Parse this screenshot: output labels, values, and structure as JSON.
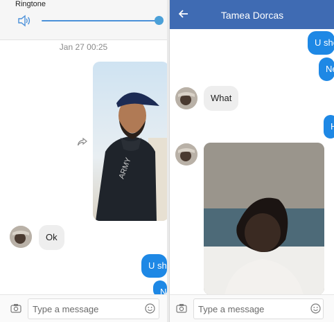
{
  "left": {
    "ringtone_label": "Ringtone",
    "volume_level": 0.95,
    "date_separator": "Jan 27 00:25",
    "messages_in": [
      {
        "text": "Ok"
      }
    ],
    "messages_out": [
      {
        "text": "U she"
      },
      {
        "text": "Ne"
      }
    ],
    "composer": {
      "placeholder": "Type a message"
    }
  },
  "right": {
    "contact_name": "Tamea Dorcas",
    "messages_out": [
      {
        "text": "U sho"
      },
      {
        "text": "Ne"
      },
      {
        "text": "H"
      }
    ],
    "messages_in": [
      {
        "text": "What"
      }
    ],
    "composer": {
      "placeholder": "Type a message"
    }
  },
  "colors": {
    "header": "#3f6bb3",
    "outgoing_bubble": "#1e88e5",
    "incoming_bubble": "#eeeeee",
    "slider": "#4ba0d8"
  },
  "icons": [
    "speaker-icon",
    "share-icon",
    "camera-icon",
    "emoji-icon",
    "back-arrow-icon"
  ]
}
